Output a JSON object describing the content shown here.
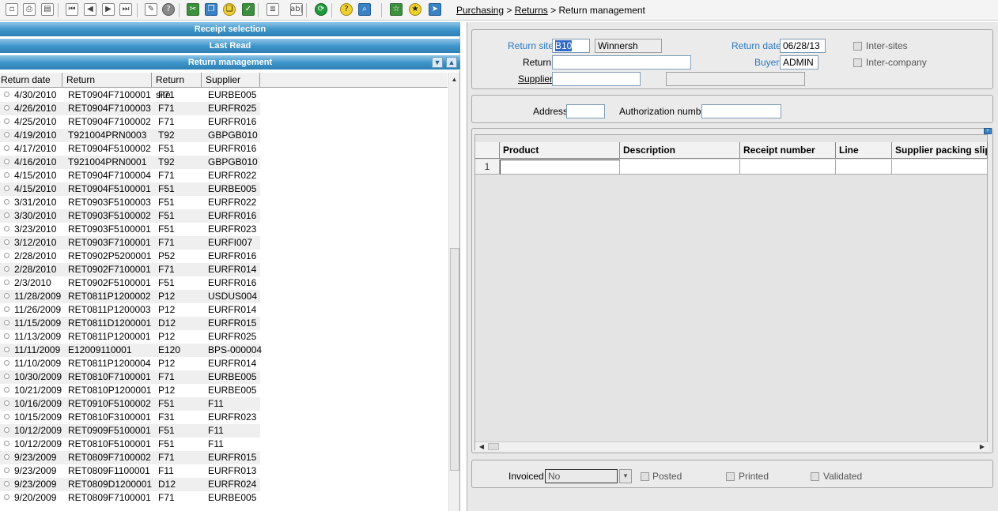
{
  "toolbar": {
    "icons": [
      {
        "name": "new-icon",
        "glyph": "▫"
      },
      {
        "name": "print-icon",
        "glyph": "⎙"
      },
      {
        "name": "print-preview-icon",
        "glyph": "▤"
      },
      {
        "name": "first-record-icon",
        "glyph": "⏮"
      },
      {
        "name": "previous-record-icon",
        "glyph": "◀"
      },
      {
        "name": "next-record-icon",
        "glyph": "▶"
      },
      {
        "name": "last-record-icon",
        "glyph": "⏭"
      },
      {
        "name": "attachment-icon",
        "glyph": "✎"
      },
      {
        "name": "help-icon",
        "glyph": "?"
      },
      {
        "name": "cut-icon",
        "glyph": "✂"
      },
      {
        "name": "copy-icon",
        "glyph": "❐"
      },
      {
        "name": "paste-icon",
        "glyph": "❏"
      },
      {
        "name": "validate-icon",
        "glyph": "✓"
      },
      {
        "name": "list-icon",
        "glyph": "≣"
      },
      {
        "name": "text-field-icon",
        "glyph": "ab|"
      },
      {
        "name": "refresh-icon",
        "glyph": "⟳"
      },
      {
        "name": "help-circle-icon",
        "glyph": "?"
      },
      {
        "name": "search-icon",
        "glyph": "⌕"
      },
      {
        "name": "favorite-outline-icon",
        "glyph": "☆"
      },
      {
        "name": "favorite-star-icon",
        "glyph": "★"
      },
      {
        "name": "direction-sign-icon",
        "glyph": "➤"
      }
    ]
  },
  "breadcrumb": {
    "level1": "Purchasing",
    "sep1": ">",
    "level2": "Returns",
    "sep2": ">",
    "current": "Return management"
  },
  "left_panel": {
    "bars": {
      "receipt_selection": "Receipt selection",
      "last_read": "Last Read",
      "return_management": "Return management"
    },
    "columns": [
      "Return date",
      "Return",
      "Return site",
      "Supplier"
    ],
    "rows": [
      [
        "4/30/2010",
        "RET0904F7100001",
        "F71",
        "EURBE005"
      ],
      [
        "4/26/2010",
        "RET0904F7100003",
        "F71",
        "EURFR025"
      ],
      [
        "4/25/2010",
        "RET0904F7100002",
        "F71",
        "EURFR016"
      ],
      [
        "4/19/2010",
        "T921004PRN0003",
        "T92",
        "GBPGB010"
      ],
      [
        "4/17/2010",
        "RET0904F5100002",
        "F51",
        "EURFR016"
      ],
      [
        "4/16/2010",
        "T921004PRN0001",
        "T92",
        "GBPGB010"
      ],
      [
        "4/15/2010",
        "RET0904F7100004",
        "F71",
        "EURFR022"
      ],
      [
        "4/15/2010",
        "RET0904F5100001",
        "F51",
        "EURBE005"
      ],
      [
        "3/31/2010",
        "RET0903F5100003",
        "F51",
        "EURFR022"
      ],
      [
        "3/30/2010",
        "RET0903F5100002",
        "F51",
        "EURFR016"
      ],
      [
        "3/23/2010",
        "RET0903F5100001",
        "F51",
        "EURFR023"
      ],
      [
        "3/12/2010",
        "RET0903F7100001",
        "F71",
        "EURFI007"
      ],
      [
        "2/28/2010",
        "RET0902P5200001",
        "P52",
        "EURFR016"
      ],
      [
        "2/28/2010",
        "RET0902F7100001",
        "F71",
        "EURFR014"
      ],
      [
        "2/3/2010",
        "RET0902F5100001",
        "F51",
        "EURFR016"
      ],
      [
        "11/28/2009",
        "RET0811P1200002",
        "P12",
        "USDUS004"
      ],
      [
        "11/26/2009",
        "RET0811P1200003",
        "P12",
        "EURFR014"
      ],
      [
        "11/15/2009",
        "RET0811D1200001",
        "D12",
        "EURFR015"
      ],
      [
        "11/13/2009",
        "RET0811P1200001",
        "P12",
        "EURFR025"
      ],
      [
        "11/11/2009",
        "E12009110001",
        "E120",
        "BPS-000004"
      ],
      [
        "11/10/2009",
        "RET0811P1200004",
        "P12",
        "EURFR014"
      ],
      [
        "10/30/2009",
        "RET0810F7100001",
        "F71",
        "EURBE005"
      ],
      [
        "10/21/2009",
        "RET0810P1200001",
        "P12",
        "EURBE005"
      ],
      [
        "10/16/2009",
        "RET0910F5100002",
        "F51",
        "F11"
      ],
      [
        "10/15/2009",
        "RET0810F3100001",
        "F31",
        "EURFR023"
      ],
      [
        "10/12/2009",
        "RET0909F5100001",
        "F51",
        "F11"
      ],
      [
        "10/12/2009",
        "RET0810F5100001",
        "F51",
        "F11"
      ],
      [
        "9/23/2009",
        "RET0809F7100002",
        "F71",
        "EURFR015"
      ],
      [
        "9/23/2009",
        "RET0809F1100001",
        "F11",
        "EURFR013"
      ],
      [
        "9/23/2009",
        "RET0809D1200001",
        "D12",
        "EURFR024"
      ],
      [
        "9/20/2009",
        "RET0809F7100001",
        "F71",
        "EURBE005"
      ]
    ]
  },
  "header_form": {
    "return_site_label": "Return site",
    "return_site_value": "B10",
    "return_site_name": "Winnersh",
    "return_date_label": "Return date",
    "return_date_value": "06/28/13",
    "intersites_label": "Inter-sites",
    "return_label": "Return",
    "return_value": "",
    "buyer_label": "Buyer",
    "buyer_value": "ADMIN",
    "intercompany_label": "Inter-company",
    "supplier_label": "Supplier",
    "supplier_value": "",
    "supplier_name": ""
  },
  "address_form": {
    "address_label": "Address",
    "address_value": "",
    "authorization_label": "Authorization number",
    "authorization_value": ""
  },
  "detail_grid": {
    "columns": [
      "Product",
      "Description",
      "Receipt number",
      "Line",
      "Supplier packing slip"
    ],
    "row_numbers": [
      "1"
    ]
  },
  "footer_form": {
    "invoiced_label": "Invoiced",
    "invoiced_value": "No",
    "posted_label": "Posted",
    "printed_label": "Printed",
    "validated_label": "Validated"
  },
  "colors": {
    "accent_label": "#2a78c2",
    "section_bar": "#3b93c8"
  }
}
